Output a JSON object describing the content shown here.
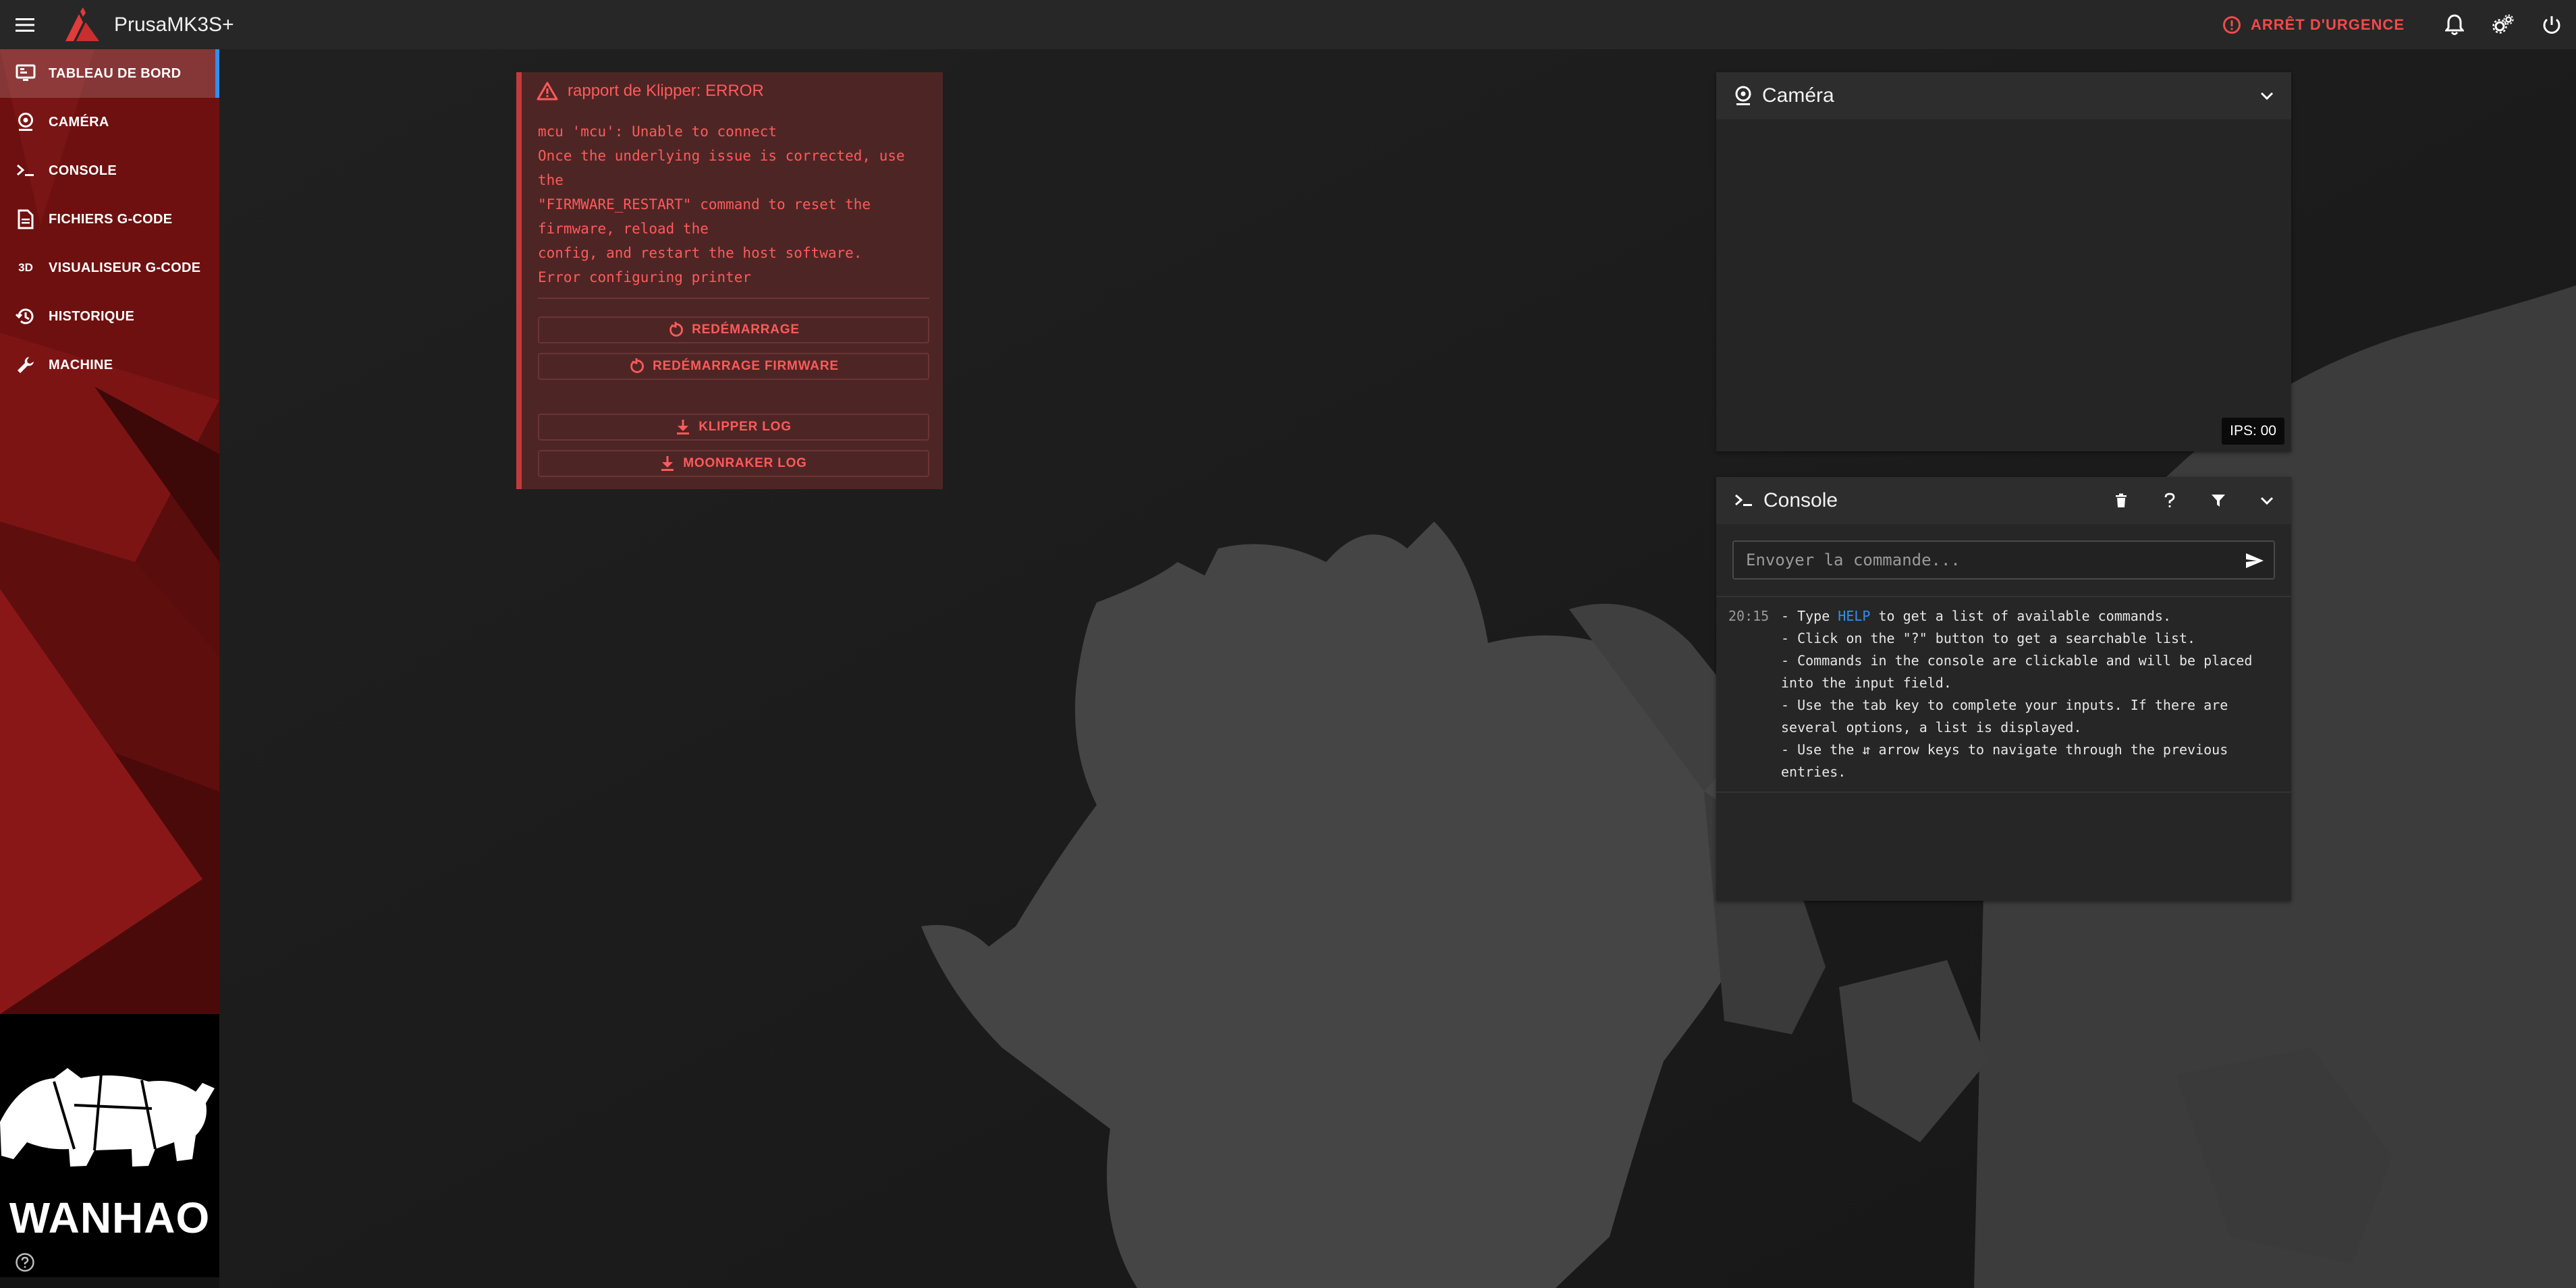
{
  "app": {
    "title": "PrusaMK3S+"
  },
  "topbar": {
    "emergency_stop_label": "ARRÊT D'URGENCE"
  },
  "sidebar": {
    "items": [
      {
        "label": "TABLEAU DE BORD",
        "icon": "monitor-dashboard-icon",
        "active": true
      },
      {
        "label": "CAMÉRA",
        "icon": "webcam-icon",
        "active": false
      },
      {
        "label": "CONSOLE",
        "icon": "console-icon",
        "active": false
      },
      {
        "label": "FICHIERS G-CODE",
        "icon": "file-document-icon",
        "active": false
      },
      {
        "label": "VISUALISEUR G-CODE",
        "icon": "3d-icon",
        "active": false
      },
      {
        "label": "HISTORIQUE",
        "icon": "history-icon",
        "active": false
      },
      {
        "label": "MACHINE",
        "icon": "wrench-icon",
        "active": false
      }
    ],
    "brand_text": "WANHAO"
  },
  "error_card": {
    "title": "rapport de Klipper: ERROR",
    "message": "mcu 'mcu': Unable to connect\nOnce the underlying issue is corrected, use\nthe\n\"FIRMWARE_RESTART\" command to reset the\nfirmware, reload the\nconfig, and restart the host software.\nError configuring printer",
    "buttons": {
      "restart": "REDÉMARRAGE",
      "firmware_restart": "REDÉMARRAGE FIRMWARE",
      "klipper_log": "KLIPPER LOG",
      "moonraker_log": "MOONRAKER LOG"
    }
  },
  "camera_panel": {
    "title": "Caméra",
    "fps_label": "IPS: 00"
  },
  "console_panel": {
    "title": "Console",
    "input_placeholder": "Envoyer la commande...",
    "entries": [
      {
        "time": "20:15",
        "line1_prefix": "- Type ",
        "line1_link": "HELP",
        "line1_suffix": " to get a list of available commands.",
        "line2": "- Click on the \"?\" button to get a searchable list.",
        "line3": "- Commands in the console are clickable and will be placed\ninto the input field.",
        "line4": "- Use the tab key to complete your inputs. If there are\nseveral options, a list is displayed.",
        "line5": "- Use the ⇵ arrow keys to navigate through the previous\nentries."
      }
    ]
  },
  "colors": {
    "accent_red": "#f24a4a",
    "active_indicator": "#2f8ff4",
    "link_blue": "#2f8ff4",
    "error_card_bg": "#4e2525"
  }
}
